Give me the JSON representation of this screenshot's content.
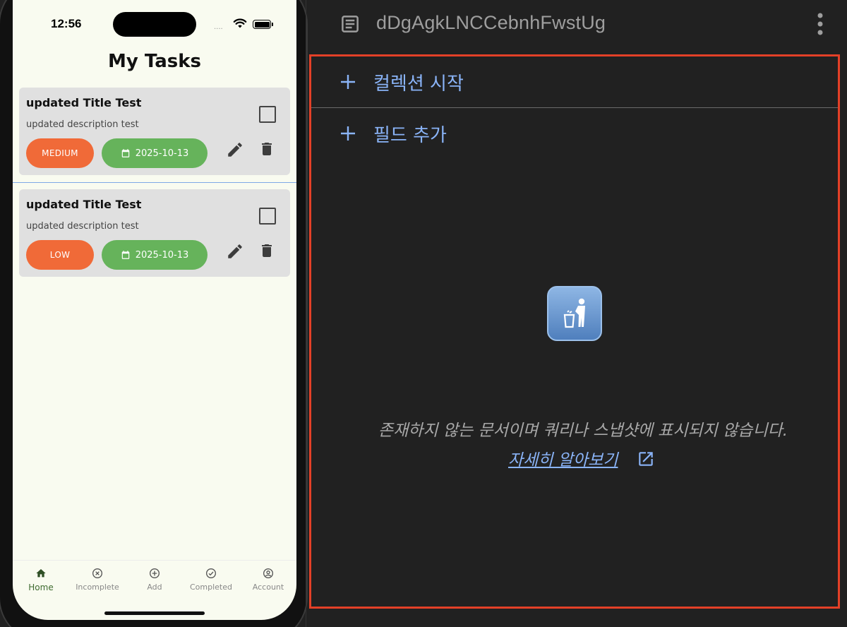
{
  "phone": {
    "status": {
      "time": "12:56",
      "signal_dots": "····"
    },
    "title": "My Tasks",
    "tasks": [
      {
        "title": "updated Title Test",
        "description": "updated description test",
        "priority": "MEDIUM",
        "date": "2025-10-13"
      },
      {
        "title": "updated Title Test",
        "description": "updated description test",
        "priority": "LOW",
        "date": "2025-10-13"
      }
    ],
    "nav": [
      {
        "label": "Home",
        "icon": "home-icon"
      },
      {
        "label": "Incomplete",
        "icon": "close-circle-icon"
      },
      {
        "label": "Add",
        "icon": "add-circle-icon"
      },
      {
        "label": "Completed",
        "icon": "check-circle-icon"
      },
      {
        "label": "Account",
        "icon": "account-circle-icon"
      }
    ]
  },
  "doc": {
    "id": "dDgAgkLNCCebnhFwstUg",
    "start_collection": "컬렉션 시작",
    "add_field": "필드 추가",
    "empty_message": "존재하지 않는 문서이며 쿼리나 스냅샷에 표시되지 않습니다.",
    "learn_more": "자세히 알아보기"
  },
  "colors": {
    "priority_chip": "#f06a38",
    "date_chip": "#66b35b",
    "accent_link": "#8ab4f8",
    "highlight": "#e34027"
  }
}
